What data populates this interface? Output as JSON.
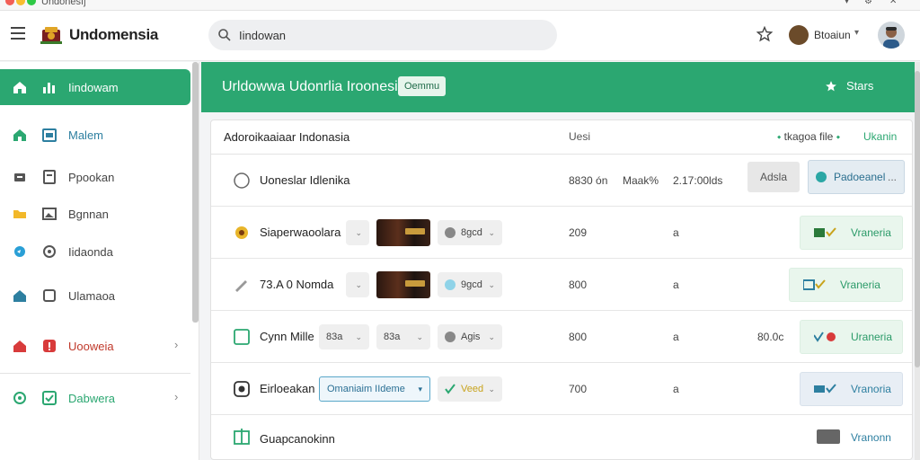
{
  "window": {
    "title": "Undonesfj",
    "colors": {
      "close": "#f25f57",
      "minimize": "#f8bd2f",
      "maximize": "#2fc946"
    }
  },
  "header": {
    "app_title": "Undomensia",
    "search_value": "Iindowan",
    "user_name": "Btoaiun",
    "icons": [
      "menu-icon",
      "logo-icon",
      "search-icon",
      "star-icon",
      "chevron-down-icon",
      "avatar"
    ]
  },
  "sidebar": {
    "items": [
      {
        "label": "Iindowam",
        "icon": "home-icon",
        "icon2": "chart-icon",
        "active": true,
        "chevron": false
      },
      {
        "label": "Malem",
        "icon": "home-icon",
        "icon2": "calendar-icon",
        "active": false,
        "chevron": false
      },
      {
        "label": "Ppookan",
        "icon": "folder-icon",
        "icon2": "document-icon",
        "active": false,
        "chevron": false
      },
      {
        "label": "Bgnnan",
        "icon": "folder-icon",
        "icon2": "image-icon",
        "active": false,
        "chevron": false
      },
      {
        "label": "Iidaonda",
        "icon": "globe-icon",
        "icon2": "refresh-icon",
        "active": false,
        "chevron": false
      },
      {
        "label": "Ulamaoa",
        "icon": "home-icon",
        "icon2": "square-icon",
        "active": false,
        "chevron": false
      },
      {
        "label": "Uooweia",
        "icon": "home-icon",
        "icon2": "warning-icon",
        "active": false,
        "chevron": true
      },
      {
        "label": "Dabwera",
        "icon": "target-icon",
        "icon2": "checkbox-icon",
        "active": false,
        "chevron": true
      }
    ]
  },
  "banner": {
    "title": "Urldowwa Udonrlia Iroonesia",
    "chip": "Oemmu",
    "action": "Stars"
  },
  "panel": {
    "title": "Adoroikaaiaar Indonasia",
    "column": "Uesi",
    "link1": "tkagoa file",
    "link2": "Ukanin",
    "rows": [
      {
        "name": "Uoneslar Idlenika",
        "v1": "8830 ón",
        "v2": "Maak%",
        "v3": "2.17:00lds",
        "gray_button": "Adsla",
        "blue_button": "Padoeanel",
        "blue_dots": "..."
      },
      {
        "name": "Siaperwaoolara",
        "dropdown": "",
        "pill": "8gcd",
        "v1": "209",
        "v2": "a",
        "action": "Vraneria"
      },
      {
        "name": "73.A 0 Nomda",
        "dropdown": "",
        "pill": "9gcd",
        "v1": "800",
        "v2": "a",
        "action": "Vraneria"
      },
      {
        "name": "Cynn Mille",
        "dropdown": "83a",
        "dropdown2": "83a",
        "pill": "Agis",
        "v1": "800",
        "v2": "a",
        "v4": "80.0c",
        "action": "Uraneria"
      },
      {
        "name": "Eirloeakan",
        "select": "Omaniaim IIdeme",
        "pill": "Veed",
        "v1": "700",
        "v2": "a",
        "action": "Vranoria"
      }
    ],
    "footer_row": {
      "name": "Guapcanokinn",
      "link": "Vranonn"
    }
  }
}
